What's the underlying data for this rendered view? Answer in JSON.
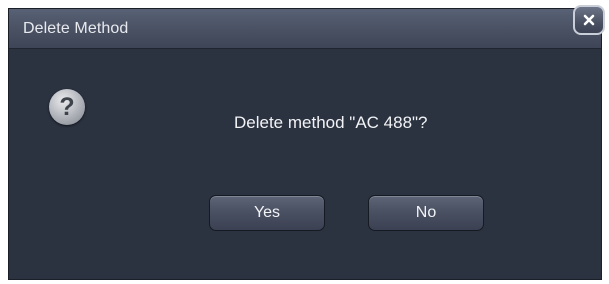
{
  "dialog": {
    "title": "Delete Method",
    "message": "Delete method \"AC 488\"?",
    "icon": "question-icon",
    "buttons": {
      "yes_label": "Yes",
      "no_label": "No"
    },
    "close_icon": "close-icon"
  }
}
